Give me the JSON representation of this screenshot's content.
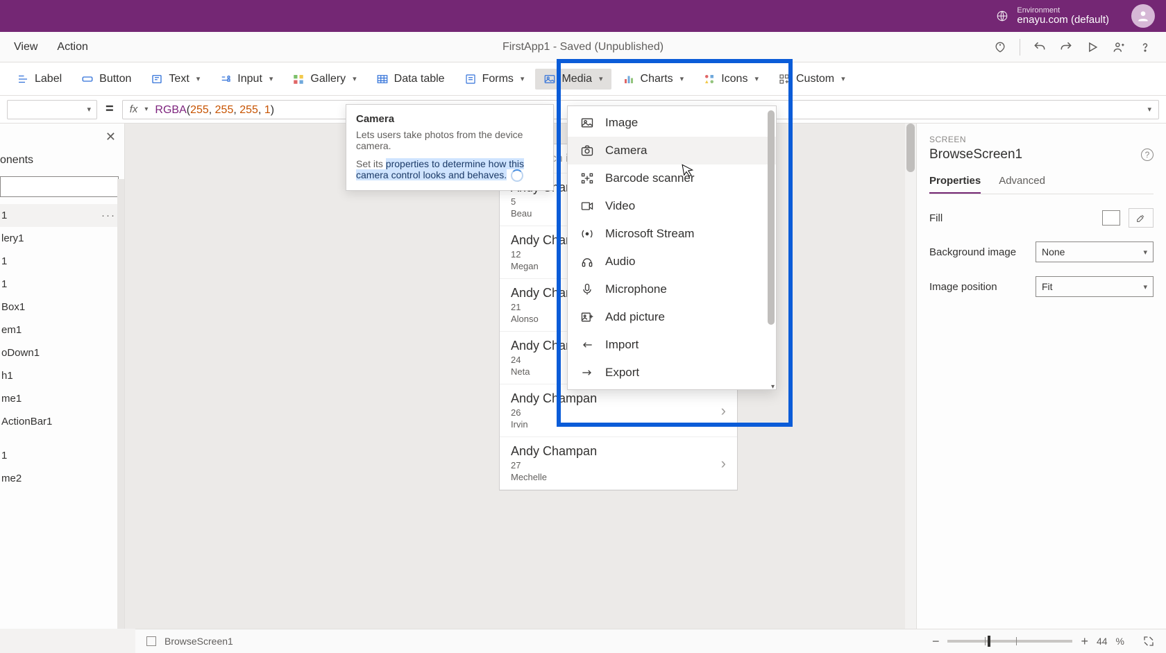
{
  "top": {
    "env_label": "Environment",
    "env_value": "enayu.com (default)"
  },
  "menubar": {
    "items": [
      "View",
      "Action"
    ],
    "app_title": "FirstApp1 - Saved (Unpublished)"
  },
  "ribbon": {
    "label": "Label",
    "button": "Button",
    "text": "Text",
    "input": "Input",
    "gallery": "Gallery",
    "datatable": "Data table",
    "forms": "Forms",
    "media": "Media",
    "charts": "Charts",
    "icons": "Icons",
    "custom": "Custom"
  },
  "formula": {
    "fn": "RGBA",
    "args": [
      "255",
      "255",
      "255",
      "1"
    ]
  },
  "tree": {
    "tab": "onents",
    "selected": "1",
    "items": [
      "lery1",
      "1",
      "1",
      "Box1",
      "em1",
      "oDown1",
      "h1",
      "me1",
      "ActionBar1",
      "",
      "1",
      "me2"
    ]
  },
  "tooltip": {
    "title": "Camera",
    "line1": "Lets users take photos from the device camera.",
    "line2a": "Set its ",
    "line2b": "properties to determine how this camera control looks and behaves."
  },
  "phone": {
    "search_ph": "Search items",
    "rows": [
      {
        "name": "Andy Champan",
        "num": "5",
        "sub": "Beau",
        "chev": false
      },
      {
        "name": "Andy Champan",
        "num": "12",
        "sub": "Megan",
        "chev": false
      },
      {
        "name": "Andy Champan",
        "num": "21",
        "sub": "Alonso",
        "chev": false
      },
      {
        "name": "Andy Champan",
        "num": "24",
        "sub": "Neta",
        "chev": true
      },
      {
        "name": "Andy Champan",
        "num": "26",
        "sub": "Irvin",
        "chev": true
      },
      {
        "name": "Andy Champan",
        "num": "27",
        "sub": "Mechelle",
        "chev": true
      }
    ]
  },
  "media_menu": {
    "items": [
      {
        "label": "Image",
        "icon": "image"
      },
      {
        "label": "Camera",
        "icon": "camera",
        "hover": true
      },
      {
        "label": "Barcode scanner",
        "icon": "barcode"
      },
      {
        "label": "Video",
        "icon": "video"
      },
      {
        "label": "Microsoft Stream",
        "icon": "stream"
      },
      {
        "label": "Audio",
        "icon": "audio"
      },
      {
        "label": "Microphone",
        "icon": "mic"
      },
      {
        "label": "Add picture",
        "icon": "addpic"
      },
      {
        "label": "Import",
        "icon": "import"
      },
      {
        "label": "Export",
        "icon": "export"
      }
    ]
  },
  "props": {
    "section": "SCREEN",
    "name": "BrowseScreen1",
    "tabs": [
      "Properties",
      "Advanced"
    ],
    "fill": "Fill",
    "bgimg": "Background image",
    "bgimg_val": "None",
    "imgpos": "Image position",
    "imgpos_val": "Fit"
  },
  "status": {
    "screen": "BrowseScreen1",
    "zoom": "44",
    "pct": "%"
  }
}
